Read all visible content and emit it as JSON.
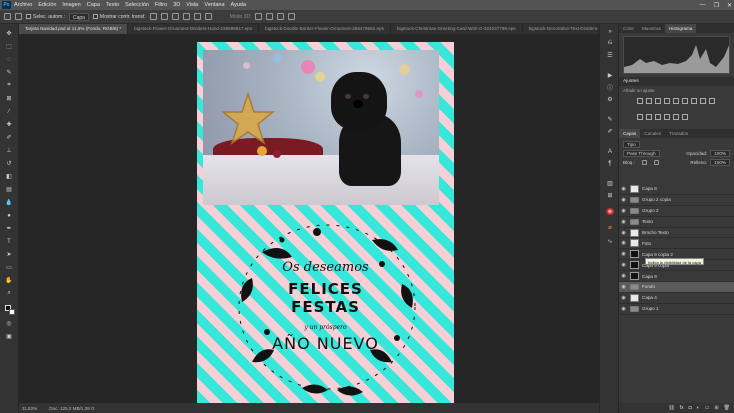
{
  "menubar": {
    "logo": "Ps",
    "items": [
      "Archivo",
      "Edición",
      "Imagen",
      "Capa",
      "Texto",
      "Selección",
      "Filtro",
      "3D",
      "Vista",
      "Ventana",
      "Ayuda"
    ],
    "win": [
      "—",
      "❐",
      "✕"
    ]
  },
  "optbar": {
    "auto_select_label": "Selec. autom.:",
    "auto_select_target": "Capa",
    "transform_label": "Mostrar contr. transf.",
    "mode_label": "Modo 3D:"
  },
  "tabs": [
    "Tarjeta Navidad.psd al 11,5% (Fondo, RGB/8) *",
    "bigstock-Flower-Ornament-Dividers-Hand-236898817.eps",
    "bigstock-Doodle-Border-Flower-Ornament-268479562.eps",
    "bigstock-Christmas-Greeting-Card-With-O-324037799.eps",
    "bigstock-Decorative-Text-Dividers-"
  ],
  "card": {
    "line1": "Os deseamos",
    "line2": "FELICES",
    "line3": "FESTAS",
    "line4": "y un próspero",
    "line5": "AÑO NUEVO"
  },
  "panels": {
    "top_tabs": [
      "Color",
      "Muestras",
      "Histograma"
    ],
    "adjust": {
      "title": "Ajustes",
      "hint": "Añadir un ajuste"
    },
    "layers_tabs": [
      "Capas",
      "Canales",
      "Trazados"
    ],
    "filter": "Tipo",
    "blend": "Pass Through",
    "opacity_label": "Opacidad:",
    "opacity": "100%",
    "lock_label": "Bloq.:",
    "fill_label": "Relleno:",
    "fill": "100%",
    "layers": [
      {
        "name": "Capa 8",
        "kind": "pixel"
      },
      {
        "name": "Grupo 2 copia",
        "kind": "folder"
      },
      {
        "name": "Grupo 2",
        "kind": "folder"
      },
      {
        "name": "Texto",
        "kind": "folder"
      },
      {
        "name": "Brocho Texto",
        "kind": "pixel"
      },
      {
        "name": "Foto",
        "kind": "pixel"
      },
      {
        "name": "Capa 9 copia 2",
        "kind": "black"
      },
      {
        "name": "Capa 9 copia",
        "kind": "black"
      },
      {
        "name": "Capa 9",
        "kind": "black"
      },
      {
        "name": "Fondo",
        "kind": "folder"
      },
      {
        "name": "Capa 4",
        "kind": "pixel"
      },
      {
        "name": "Grupo 1",
        "kind": "folder"
      }
    ],
    "tooltip": "Indica la visibilidad de la capa"
  },
  "status": {
    "zoom": "11,52%",
    "doc": "Doc: 125,2 MB/1,28 G"
  },
  "colors": {
    "cyan": "#37e7da",
    "pink": "#f7cfd7",
    "accent": "#31a8ff"
  }
}
